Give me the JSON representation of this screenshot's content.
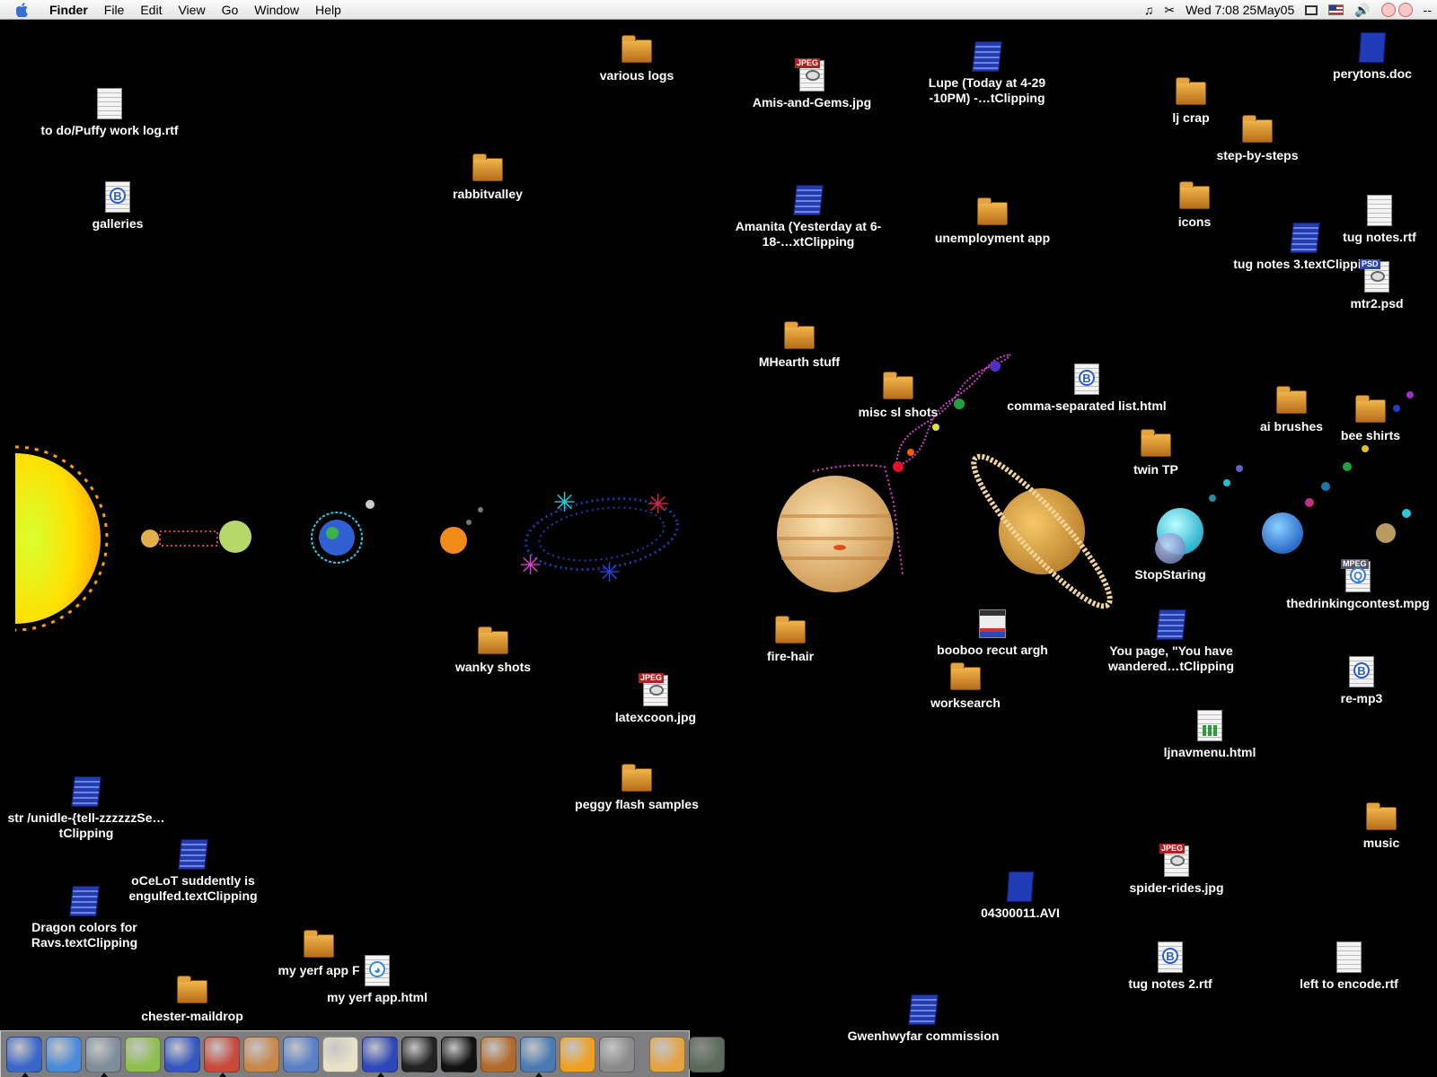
{
  "menubar": {
    "app_name": "Finder",
    "items": [
      "File",
      "Edit",
      "View",
      "Go",
      "Window",
      "Help"
    ],
    "clock": "Wed 7:08  25May05"
  },
  "desktop_icons": [
    {
      "label": "to do/Puffy work log.rtf",
      "type": "doc"
    },
    {
      "label": "galleries",
      "type": "bbedit"
    },
    {
      "label": "various logs",
      "type": "folder"
    },
    {
      "label": "rabbitvalley",
      "type": "folder"
    },
    {
      "label": "Amis-and-Gems.jpg",
      "type": "jpeg"
    },
    {
      "label": "Lupe (Today at 4-29 -10PM) -…tClipping",
      "type": "clipping"
    },
    {
      "label": "perytons.doc",
      "type": "bluedoc"
    },
    {
      "label": "lj crap",
      "type": "folder"
    },
    {
      "label": "step-by-steps",
      "type": "folder"
    },
    {
      "label": "icons",
      "type": "folder"
    },
    {
      "label": "tug notes.rtf",
      "type": "doc"
    },
    {
      "label": "tug notes 3.textClipping",
      "type": "clipping"
    },
    {
      "label": "mtr2.psd",
      "type": "psd"
    },
    {
      "label": "Amanita (Yesterday at 6-18-…xtClipping",
      "type": "clipping"
    },
    {
      "label": "unemployment app",
      "type": "folder"
    },
    {
      "label": "MHearth stuff",
      "type": "folder"
    },
    {
      "label": "misc sl shots",
      "type": "folder"
    },
    {
      "label": "comma-separated list.html",
      "type": "bbedit"
    },
    {
      "label": "ai brushes",
      "type": "folder"
    },
    {
      "label": "bee shirts",
      "type": "folder"
    },
    {
      "label": "twin TP",
      "type": "folder"
    },
    {
      "label": "StopStaring",
      "type": "folder"
    },
    {
      "label": "thedrinkingcontest.mpg",
      "type": "mpeg"
    },
    {
      "label": "wanky shots",
      "type": "folder"
    },
    {
      "label": "fire-hair",
      "type": "folder"
    },
    {
      "label": "booboo recut argh",
      "type": "movie"
    },
    {
      "label": "You page, \"You have wandered…tClipping",
      "type": "clipping"
    },
    {
      "label": "latexcoon.jpg",
      "type": "jpeg"
    },
    {
      "label": "worksearch",
      "type": "folder"
    },
    {
      "label": "re-mp3",
      "type": "bbedit"
    },
    {
      "label": "ljnavmenu.html",
      "type": "chartdoc"
    },
    {
      "label": "peggy flash samples",
      "type": "folder"
    },
    {
      "label": "str /unidle-{tell-zzzzzzSe…tClipping",
      "type": "clipping"
    },
    {
      "label": "oCeLoT suddently is engulfed.textClipping",
      "type": "clipping"
    },
    {
      "label": "Dragon colors for Ravs.textClipping",
      "type": "clipping"
    },
    {
      "label": "my yerf app F",
      "type": "folder"
    },
    {
      "label": "my yerf app.html",
      "type": "safari"
    },
    {
      "label": "chester-maildrop",
      "type": "folder"
    },
    {
      "label": "music",
      "type": "folder"
    },
    {
      "label": "spider-rides.jpg",
      "type": "jpeg"
    },
    {
      "label": "04300011.AVI",
      "type": "bluedoc"
    },
    {
      "label": "tug notes 2.rtf",
      "type": "bbedit"
    },
    {
      "label": "left to encode.rtf",
      "type": "doc"
    },
    {
      "label": "Gwenhwyfar commission",
      "type": "clipping"
    }
  ],
  "dock": {
    "apps": [
      {
        "name": "finder-icon",
        "color": "#3a66c8"
      },
      {
        "name": "safari-icon",
        "color": "#4a8ad8"
      },
      {
        "name": "system-preferences-icon",
        "color": "#7f8c99"
      },
      {
        "name": "itunes-icon",
        "color": "#8fbf4f"
      },
      {
        "name": "iphoto-icon",
        "color": "#3656c0"
      },
      {
        "name": "pencil-icon",
        "color": "#c84a3a"
      },
      {
        "name": "portrait-app-icon",
        "color": "#c9874a"
      },
      {
        "name": "preview-icon",
        "color": "#5a7fc7"
      },
      {
        "name": "textedit-icon",
        "color": "#e8e2c8"
      },
      {
        "name": "bbedit-icon",
        "color": "#2d47b8"
      },
      {
        "name": "myople-icon",
        "color": "#222222"
      },
      {
        "name": "terminal-icon",
        "color": "#111111"
      },
      {
        "name": "chat-icon",
        "color": "#b26a2a"
      },
      {
        "name": "mail-icon",
        "color": "#4a7ab0"
      },
      {
        "name": "sunburst-icon",
        "color": "#f0a020"
      },
      {
        "name": "moon-icon",
        "color": "#8a8a8a"
      }
    ],
    "right": [
      {
        "name": "documents-folder-icon",
        "color": "#e4a341"
      },
      {
        "name": "trash-icon",
        "color": "#5a6a5a"
      }
    ]
  }
}
